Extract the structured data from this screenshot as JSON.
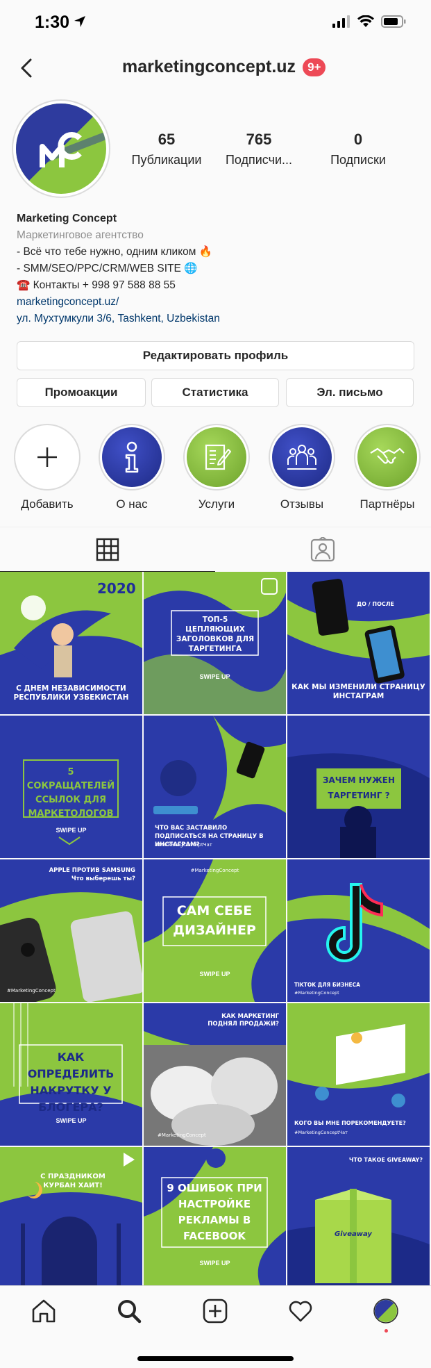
{
  "status_bar": {
    "time": "1:30"
  },
  "header": {
    "title": "marketingconcept.uz",
    "badge": "9+"
  },
  "profile": {
    "stats": [
      {
        "value": "65",
        "label": "Публикации"
      },
      {
        "value": "765",
        "label": "Подписчи..."
      },
      {
        "value": "0",
        "label": "Подписки"
      }
    ],
    "name": "Marketing Concept",
    "category": "Маркетинговое агентство",
    "bio_lines": [
      "- Всё что тебе нужно, одним кликом 🔥",
      "- SMM/SEO/PPC/CRM/WEB SITE 🌐",
      "☎️ Контакты + 998 97 588 88 55"
    ],
    "website": "marketingconcept.uz/",
    "address": "ул. Мухтумкули 3/6, Tashkent, Uzbekistan"
  },
  "buttons": {
    "edit_profile": "Редактировать профиль",
    "promotions": "Промоакции",
    "insights": "Статистика",
    "email": "Эл. письмо"
  },
  "highlights": [
    {
      "label": "Добавить",
      "icon": "plus-icon"
    },
    {
      "label": "О нас",
      "icon": "info-icon"
    },
    {
      "label": "Услуги",
      "icon": "clipboard-icon"
    },
    {
      "label": "Отзывы",
      "icon": "people-icon"
    },
    {
      "label": "Партнёры",
      "icon": "handshake-icon"
    }
  ],
  "grid_posts": [
    {
      "text": "С ДНЕМ НЕЗАВИСИМОСТИ РЕСПУБЛИКИ УЗБЕКИСТАН",
      "extra": "2020"
    },
    {
      "text": "ТОП-5 ЦЕПЛЯЮЩИХ ЗАГОЛОВКОВ ДЛЯ ТАРГЕТИНГА",
      "extra": "SWIPE UP"
    },
    {
      "text": "КАК МЫ ИЗМЕНИЛИ СТРАНИЦУ ИНСТАГРАМ",
      "extra": "ДО / ПОСЛЕ"
    },
    {
      "text": "5 СОКРАЩАТЕЛЕЙ ССЫЛОК ДЛЯ МАРКЕТОЛОГОВ",
      "extra": "SWIPE UP"
    },
    {
      "text": "ЧТО ВАС ЗАСТАВИЛО ПОДПИСАТЬСЯ НА СТРАНИЦУ В ИНСТАГРАМ?",
      "extra": "#MarketingConceptЧат"
    },
    {
      "text": "ЗАЧЕМ НУЖЕН ТАРГЕТИНГ ?",
      "extra": ""
    },
    {
      "text": "APPLE ПРОТИВ SAMSUNG Что выберешь ты?",
      "extra": "#MarketingConcept"
    },
    {
      "text": "САМ СЕБЕ ДИЗАЙНЕР",
      "extra": "SWIPE UP"
    },
    {
      "text": "TIKTOK ДЛЯ БИЗНЕСА",
      "extra": "#MarketingConcept"
    },
    {
      "text": "КАК ОПРЕДЕЛИТЬ НАКРУТКУ У БЛОГЕРА?",
      "extra": "SWIPE UP"
    },
    {
      "text": "КАК МАРКЕТИНГ ПОДНЯЛ ПРОДАЖИ?",
      "extra": "#MarketingConcept"
    },
    {
      "text": "КОГО ВЫ МНЕ ПОРЕКОМЕНДУЕТЕ?",
      "extra": "#MarketingConceptЧат"
    },
    {
      "text": "С ПРАЗДНИКОМ КУРБАН ХАИТ!",
      "extra": ""
    },
    {
      "text": "9 ОШИБОК ПРИ НАСТРОЙКЕ РЕКЛАМЫ В FACEBOOK",
      "extra": "SWIPE UP"
    },
    {
      "text": "ЧТО ТАКОЕ GIVEAWAY?",
      "extra": "Giveaway"
    }
  ],
  "colors": {
    "brand_blue": "#2e3b9e",
    "brand_green": "#8cc63f",
    "badge_red": "#ed4956",
    "link": "#00376b"
  }
}
